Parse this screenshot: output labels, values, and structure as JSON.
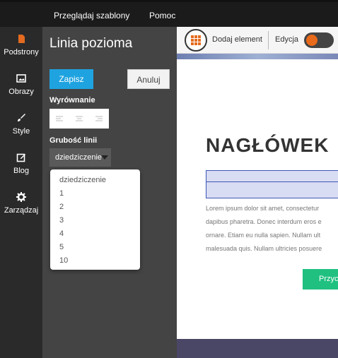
{
  "topbar": {
    "menu": [
      {
        "label": "Przeglądaj szablony"
      },
      {
        "label": "Pomoc"
      }
    ]
  },
  "leftnav": {
    "items": [
      {
        "label": "Podstrony",
        "icon": "page-icon",
        "color": "#e46b1f"
      },
      {
        "label": "Obrazy",
        "icon": "image-icon"
      },
      {
        "label": "Style",
        "icon": "brush-icon"
      },
      {
        "label": "Blog",
        "icon": "edit-square-icon"
      },
      {
        "label": "Zarządzaj",
        "icon": "gear-icon"
      }
    ]
  },
  "panel": {
    "title": "Linia pozioma",
    "save_label": "Zapisz",
    "cancel_label": "Anuluj",
    "align_label": "Wyrównanie",
    "align_options": [
      "left-align-icon",
      "center-align-icon",
      "right-align-icon"
    ],
    "thickness_label": "Grubość linii",
    "thickness_value": "dziedziczenie",
    "thickness_options": [
      "dziedziczenie",
      "1",
      "2",
      "3",
      "4",
      "5",
      "10"
    ]
  },
  "preview": {
    "toolbar": {
      "add_label": "Dodaj element",
      "edit_label": "Edycja",
      "toggle_on": true
    },
    "heading": "NAGŁÓWEK",
    "body_lines": [
      "Lorem ipsum dolor sit amet, consectetur",
      "dapibus pharetra. Donec interdum eros e",
      "ornare. Etiam eu nulla sapien. Nullam ult",
      "malesuada quis. Nullam ultricies posuere"
    ],
    "cta_label": "Przyc"
  },
  "colors": {
    "accent": "#1fa3e0",
    "brand_orange": "#e46b1f",
    "selection": "#3d56b5",
    "cta": "#20c080"
  }
}
